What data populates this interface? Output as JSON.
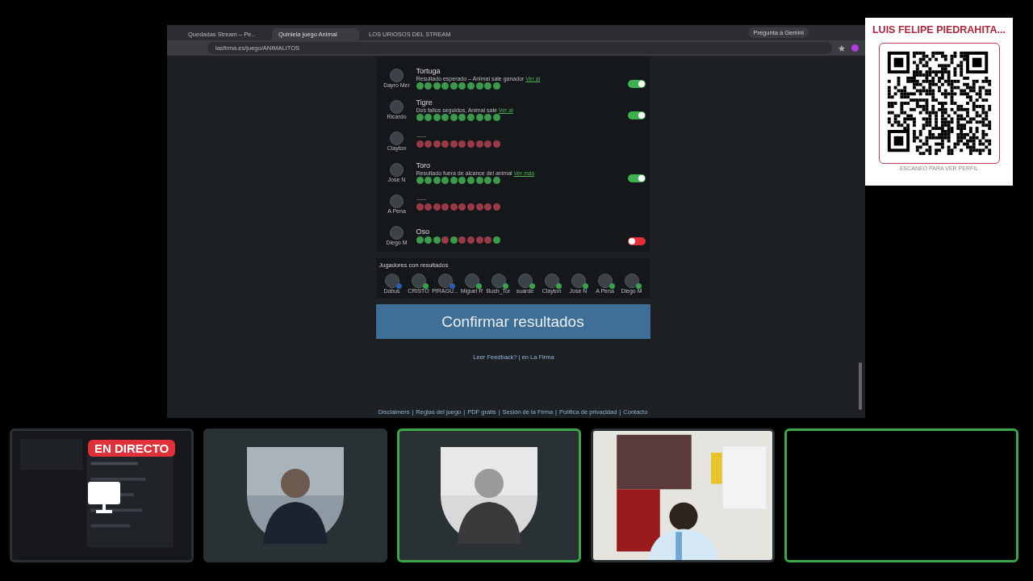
{
  "browser": {
    "tabs": [
      {
        "label": "Quedadas Stream – Pe...",
        "selected": false
      },
      {
        "label": "Quiniela juego Animal",
        "selected": true
      },
      {
        "label": "LOS URIOSOS DEL STREAM",
        "selected": false
      }
    ],
    "address": "lasfirma.es/juego/ANIMALITOS",
    "profile_button": "Pregunta a Gemini"
  },
  "rows": [
    {
      "player": "Dayro Mer",
      "answered": true,
      "title": "Tortuga",
      "note": "Resultado esperado – Animal sale ganador",
      "note_link": "Ver al",
      "dots": [
        true,
        true,
        true,
        true,
        true,
        true,
        true,
        true,
        true,
        true
      ],
      "toggle": {
        "on": true
      }
    },
    {
      "player": "Ricardo",
      "answered": true,
      "title": "Tigre",
      "note": "Dos fallos seguidos, Animal sale",
      "note_link": "Ver al",
      "dots": [
        true,
        true,
        true,
        true,
        true,
        true,
        true,
        true,
        true,
        true
      ],
      "toggle": {
        "on": true
      }
    },
    {
      "player": "Clayton",
      "answered": false,
      "dots": [
        false,
        false,
        false,
        false,
        false,
        false,
        false,
        false,
        false,
        false
      ]
    },
    {
      "player": "Jose N",
      "answered": true,
      "title": "Toro",
      "note": "Resultado fuera de alcance del animal",
      "note_link": "Ver más",
      "dots": [
        true,
        true,
        true,
        true,
        true,
        true,
        true,
        true,
        true,
        true
      ],
      "toggle": {
        "on": true
      }
    },
    {
      "player": "A Pena",
      "answered": false,
      "dots": [
        false,
        false,
        false,
        false,
        false,
        false,
        false,
        false,
        false,
        false
      ]
    },
    {
      "player": "Diego M",
      "answered": true,
      "title": "Oso",
      "dots": [
        true,
        true,
        true,
        false,
        true,
        false,
        false,
        false,
        false,
        true
      ],
      "toggle": {
        "on": false
      }
    }
  ],
  "results": {
    "heading": "Jugadores con resultados",
    "players": [
      {
        "name": "Dobus",
        "color": "#2a5fa8"
      },
      {
        "name": "CRISTO",
        "color": "#3aa04a"
      },
      {
        "name": "PIRAGU...",
        "color": "#2a5fa8"
      },
      {
        "name": "Miguel R",
        "color": "#3aa04a"
      },
      {
        "name": "Bush_Tor",
        "color": "#3aa04a"
      },
      {
        "name": "suarde",
        "color": "#3aa04a"
      },
      {
        "name": "Clayton",
        "color": "#3aa04a"
      },
      {
        "name": "Jose N",
        "color": "#3aa04a"
      },
      {
        "name": "A Pena",
        "color": "#3aa04a"
      },
      {
        "name": "Diego M",
        "color": "#3aa04a"
      }
    ]
  },
  "confirm_button": "Confirmar resultados",
  "feedback_link": "Leer Feedback? | en La Firma",
  "footer_separator": "|",
  "footer_links": [
    "Disclaimers",
    "Reglas del juego",
    "PDF gratis",
    "Sesión de la Firma",
    "Política de privacidad",
    "Contacto"
  ],
  "qr_card": {
    "name": "LUIS FELIPE PIEDRAHITA...",
    "caption": "ESCANEO PARA VER PERFIL"
  },
  "tiles": [
    {
      "kind": "screen",
      "live_badge": "EN DIRECTO",
      "speaking": false
    },
    {
      "kind": "avatar",
      "speaking": false
    },
    {
      "kind": "avatar",
      "speaking": true
    },
    {
      "kind": "camera",
      "speaking": false
    },
    {
      "kind": "empty",
      "speaking": true
    }
  ]
}
